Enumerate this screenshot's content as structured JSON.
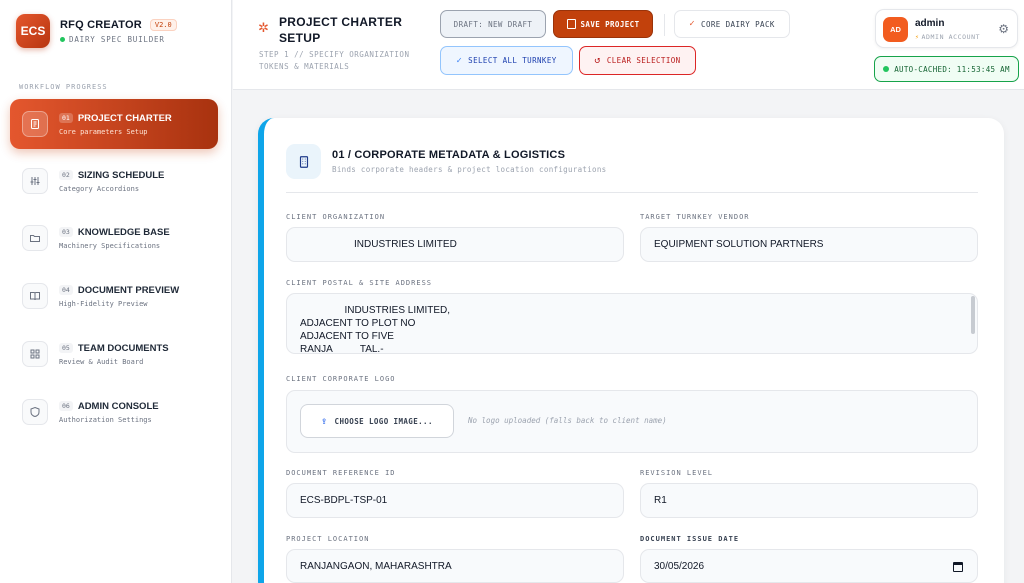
{
  "brand": {
    "logo": "ECS",
    "title": "RFQ CREATOR",
    "version": "V2.0",
    "subtitle": "DAIRY SPEC BUILDER"
  },
  "sidebar": {
    "section_label": "WORKFLOW PROGRESS",
    "items": [
      {
        "num": "01",
        "title": "PROJECT CHARTER",
        "sub": "Core parameters Setup",
        "icon": "document-icon",
        "active": true
      },
      {
        "num": "02",
        "title": "SIZING SCHEDULE",
        "sub": "Category Accordions",
        "icon": "sliders-icon"
      },
      {
        "num": "03",
        "title": "KNOWLEDGE BASE",
        "sub": "Machinery Specifications",
        "icon": "folder-icon"
      },
      {
        "num": "04",
        "title": "DOCUMENT PREVIEW",
        "sub": "High-Fidelity Preview",
        "icon": "book-icon"
      },
      {
        "num": "05",
        "title": "TEAM DOCUMENTS",
        "sub": "Review & Audit Board",
        "icon": "grid-icon"
      },
      {
        "num": "06",
        "title": "ADMIN CONSOLE",
        "sub": "Authorization Settings",
        "icon": "shield-icon"
      }
    ]
  },
  "header": {
    "title": "PROJECT CHARTER SETUP",
    "subtitle": "STEP 1 // SPECIFY ORGANIZATION TOKENS & MATERIALS",
    "draft_label": "DRAFT: NEW DRAFT",
    "save_label": "SAVE PROJECT",
    "core_label": "CORE DAIRY PACK",
    "select_label": "SELECT ALL TURNKEY",
    "clear_label": "CLEAR SELECTION"
  },
  "user": {
    "initials": "AD",
    "name": "admin",
    "role": "ADMIN ACCOUNT"
  },
  "autosave": "AUTO-CACHED: 11:53:45 AM",
  "section": {
    "title": "01 / CORPORATE METADATA & LOGISTICS",
    "subtitle": "Binds corporate headers & project location configurations"
  },
  "form": {
    "client_org_label": "CLIENT ORGANIZATION",
    "client_org_value": "INDUSTRIES LIMITED",
    "vendor_label": "TARGET TURNKEY VENDOR",
    "vendor_value": "EQUIPMENT SOLUTION PARTNERS",
    "address_label": "CLIENT POSTAL & SITE ADDRESS",
    "address_value": "                INDUSTRIES LIMITED,\nADJACENT TO PLOT NO\nADJACENT TO FIVE\nRANJA          TAL.-",
    "logo_label": "CLIENT CORPORATE LOGO",
    "logo_button": "CHOOSE LOGO IMAGE...",
    "logo_hint": "No logo uploaded (falls back to client name)",
    "docref_label": "DOCUMENT REFERENCE ID",
    "docref_value": "ECS-BDPL-TSP-01",
    "revision_label": "REVISION LEVEL",
    "revision_value": "R1",
    "location_label": "PROJECT LOCATION",
    "location_value": "RANJANGAON, MAHARASHTRA",
    "issue_date_label": "DOCUMENT ISSUE DATE",
    "issue_date_value": "30/05/2026"
  }
}
